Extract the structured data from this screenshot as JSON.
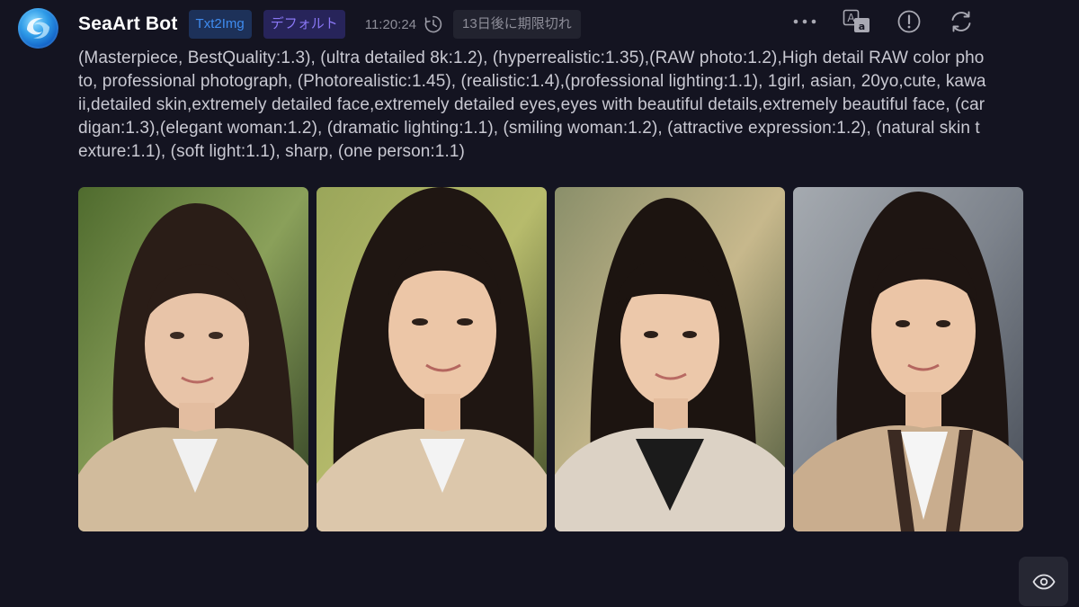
{
  "header": {
    "bot_name": "SeaArt Bot",
    "tag_mode": "Txt2Img",
    "tag_style": "デフォルト",
    "time": "11:20:24",
    "expire": "13日後に期限切れ"
  },
  "actions": {
    "more_icon": "more-icon",
    "translate_icon": "translate-icon",
    "report_icon": "report-icon",
    "regenerate_icon": "refresh-icon"
  },
  "prompt": "(Masterpiece, BestQuality:1.3), (ultra detailed 8k:1.2), (hyperrealistic:1.35),(RAW photo:1.2),High detail RAW color photo, professional photograph, (Photorealistic:1.45), (realistic:1.4),(professional lighting:1.1), 1girl, asian, 20yo,cute, kawaii,detailed skin,extremely detailed face,extremely detailed eyes,eyes with beautiful details,extremely beautiful face, (cardigan:1.3),(elegant woman:1.2), (dramatic lighting:1.1), (smiling woman:1.2), (attractive expression:1.2), (natural skin texture:1.1), (soft light:1.1), sharp, (one person:1.1)",
  "images": [
    {
      "name": "generated-image-1",
      "bg": "#3f5a2c",
      "cardigan": "#c9b79c",
      "shirt": "#f1f1f1"
    },
    {
      "name": "generated-image-2",
      "bg": "#6d7a3a",
      "cardigan": "#d6c3a8",
      "shirt": "#f3f3f3"
    },
    {
      "name": "generated-image-3",
      "bg": "#5d6a4a",
      "cardigan": "#d8cfc4",
      "shirt": "#1b1b1b"
    },
    {
      "name": "generated-image-4",
      "bg": "#6b7078",
      "cardigan": "#c7ab8c",
      "shirt": "#f5f5f5"
    }
  ],
  "colors": {
    "background": "#141421",
    "tag_mode_bg": "#1d3159",
    "tag_mode_text": "#3f8cf0",
    "tag_style_bg": "#27245a",
    "tag_style_text": "#8a77f5"
  }
}
